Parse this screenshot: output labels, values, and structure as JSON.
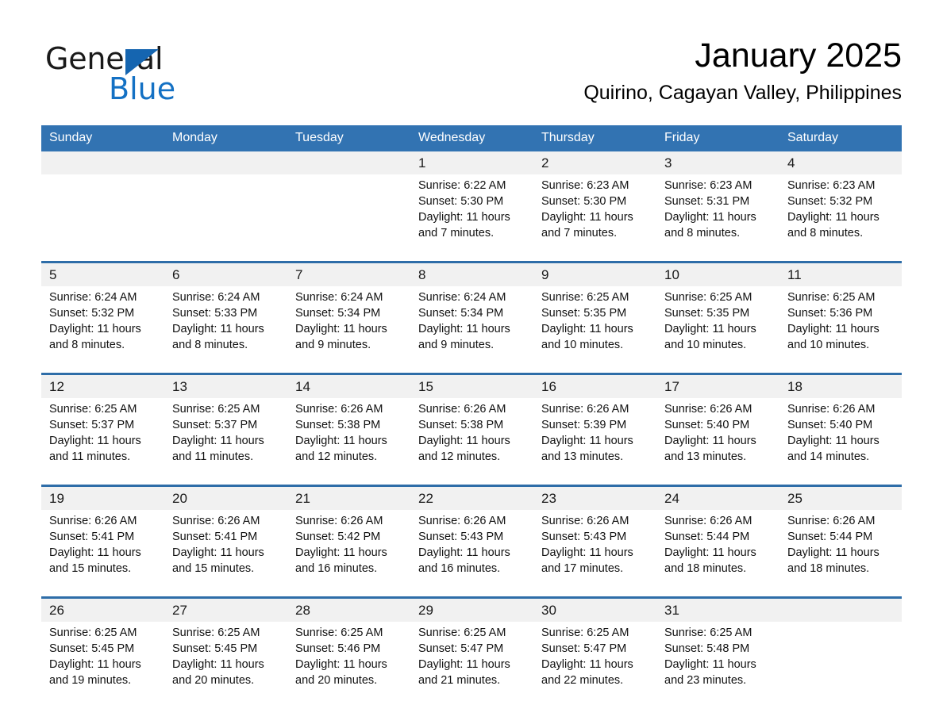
{
  "brand": {
    "name_part1": "General",
    "name_part2": "Blue",
    "logo_icon": "triangle-logo-icon"
  },
  "header": {
    "month_title": "January 2025",
    "location": "Quirino, Cagayan Valley, Philippines"
  },
  "colors": {
    "header_blue": "#3273b2",
    "separator_blue": "#2e6da8",
    "daynum_bg": "#f1f1f1",
    "brand_blue": "#1471c4"
  },
  "calendar": {
    "weekday_headers": [
      "Sunday",
      "Monday",
      "Tuesday",
      "Wednesday",
      "Thursday",
      "Friday",
      "Saturday"
    ],
    "weeks": [
      {
        "days": [
          {
            "num": "",
            "sunrise": "",
            "sunset": "",
            "daylight_1": "",
            "daylight_2": "",
            "empty": true
          },
          {
            "num": "",
            "sunrise": "",
            "sunset": "",
            "daylight_1": "",
            "daylight_2": "",
            "empty": true
          },
          {
            "num": "",
            "sunrise": "",
            "sunset": "",
            "daylight_1": "",
            "daylight_2": "",
            "empty": true
          },
          {
            "num": "1",
            "sunrise": "Sunrise: 6:22 AM",
            "sunset": "Sunset: 5:30 PM",
            "daylight_1": "Daylight: 11 hours",
            "daylight_2": "and 7 minutes.",
            "empty": false
          },
          {
            "num": "2",
            "sunrise": "Sunrise: 6:23 AM",
            "sunset": "Sunset: 5:30 PM",
            "daylight_1": "Daylight: 11 hours",
            "daylight_2": "and 7 minutes.",
            "empty": false
          },
          {
            "num": "3",
            "sunrise": "Sunrise: 6:23 AM",
            "sunset": "Sunset: 5:31 PM",
            "daylight_1": "Daylight: 11 hours",
            "daylight_2": "and 8 minutes.",
            "empty": false
          },
          {
            "num": "4",
            "sunrise": "Sunrise: 6:23 AM",
            "sunset": "Sunset: 5:32 PM",
            "daylight_1": "Daylight: 11 hours",
            "daylight_2": "and 8 minutes.",
            "empty": false
          }
        ]
      },
      {
        "days": [
          {
            "num": "5",
            "sunrise": "Sunrise: 6:24 AM",
            "sunset": "Sunset: 5:32 PM",
            "daylight_1": "Daylight: 11 hours",
            "daylight_2": "and 8 minutes.",
            "empty": false
          },
          {
            "num": "6",
            "sunrise": "Sunrise: 6:24 AM",
            "sunset": "Sunset: 5:33 PM",
            "daylight_1": "Daylight: 11 hours",
            "daylight_2": "and 8 minutes.",
            "empty": false
          },
          {
            "num": "7",
            "sunrise": "Sunrise: 6:24 AM",
            "sunset": "Sunset: 5:34 PM",
            "daylight_1": "Daylight: 11 hours",
            "daylight_2": "and 9 minutes.",
            "empty": false
          },
          {
            "num": "8",
            "sunrise": "Sunrise: 6:24 AM",
            "sunset": "Sunset: 5:34 PM",
            "daylight_1": "Daylight: 11 hours",
            "daylight_2": "and 9 minutes.",
            "empty": false
          },
          {
            "num": "9",
            "sunrise": "Sunrise: 6:25 AM",
            "sunset": "Sunset: 5:35 PM",
            "daylight_1": "Daylight: 11 hours",
            "daylight_2": "and 10 minutes.",
            "empty": false
          },
          {
            "num": "10",
            "sunrise": "Sunrise: 6:25 AM",
            "sunset": "Sunset: 5:35 PM",
            "daylight_1": "Daylight: 11 hours",
            "daylight_2": "and 10 minutes.",
            "empty": false
          },
          {
            "num": "11",
            "sunrise": "Sunrise: 6:25 AM",
            "sunset": "Sunset: 5:36 PM",
            "daylight_1": "Daylight: 11 hours",
            "daylight_2": "and 10 minutes.",
            "empty": false
          }
        ]
      },
      {
        "days": [
          {
            "num": "12",
            "sunrise": "Sunrise: 6:25 AM",
            "sunset": "Sunset: 5:37 PM",
            "daylight_1": "Daylight: 11 hours",
            "daylight_2": "and 11 minutes.",
            "empty": false
          },
          {
            "num": "13",
            "sunrise": "Sunrise: 6:25 AM",
            "sunset": "Sunset: 5:37 PM",
            "daylight_1": "Daylight: 11 hours",
            "daylight_2": "and 11 minutes.",
            "empty": false
          },
          {
            "num": "14",
            "sunrise": "Sunrise: 6:26 AM",
            "sunset": "Sunset: 5:38 PM",
            "daylight_1": "Daylight: 11 hours",
            "daylight_2": "and 12 minutes.",
            "empty": false
          },
          {
            "num": "15",
            "sunrise": "Sunrise: 6:26 AM",
            "sunset": "Sunset: 5:38 PM",
            "daylight_1": "Daylight: 11 hours",
            "daylight_2": "and 12 minutes.",
            "empty": false
          },
          {
            "num": "16",
            "sunrise": "Sunrise: 6:26 AM",
            "sunset": "Sunset: 5:39 PM",
            "daylight_1": "Daylight: 11 hours",
            "daylight_2": "and 13 minutes.",
            "empty": false
          },
          {
            "num": "17",
            "sunrise": "Sunrise: 6:26 AM",
            "sunset": "Sunset: 5:40 PM",
            "daylight_1": "Daylight: 11 hours",
            "daylight_2": "and 13 minutes.",
            "empty": false
          },
          {
            "num": "18",
            "sunrise": "Sunrise: 6:26 AM",
            "sunset": "Sunset: 5:40 PM",
            "daylight_1": "Daylight: 11 hours",
            "daylight_2": "and 14 minutes.",
            "empty": false
          }
        ]
      },
      {
        "days": [
          {
            "num": "19",
            "sunrise": "Sunrise: 6:26 AM",
            "sunset": "Sunset: 5:41 PM",
            "daylight_1": "Daylight: 11 hours",
            "daylight_2": "and 15 minutes.",
            "empty": false
          },
          {
            "num": "20",
            "sunrise": "Sunrise: 6:26 AM",
            "sunset": "Sunset: 5:41 PM",
            "daylight_1": "Daylight: 11 hours",
            "daylight_2": "and 15 minutes.",
            "empty": false
          },
          {
            "num": "21",
            "sunrise": "Sunrise: 6:26 AM",
            "sunset": "Sunset: 5:42 PM",
            "daylight_1": "Daylight: 11 hours",
            "daylight_2": "and 16 minutes.",
            "empty": false
          },
          {
            "num": "22",
            "sunrise": "Sunrise: 6:26 AM",
            "sunset": "Sunset: 5:43 PM",
            "daylight_1": "Daylight: 11 hours",
            "daylight_2": "and 16 minutes.",
            "empty": false
          },
          {
            "num": "23",
            "sunrise": "Sunrise: 6:26 AM",
            "sunset": "Sunset: 5:43 PM",
            "daylight_1": "Daylight: 11 hours",
            "daylight_2": "and 17 minutes.",
            "empty": false
          },
          {
            "num": "24",
            "sunrise": "Sunrise: 6:26 AM",
            "sunset": "Sunset: 5:44 PM",
            "daylight_1": "Daylight: 11 hours",
            "daylight_2": "and 18 minutes.",
            "empty": false
          },
          {
            "num": "25",
            "sunrise": "Sunrise: 6:26 AM",
            "sunset": "Sunset: 5:44 PM",
            "daylight_1": "Daylight: 11 hours",
            "daylight_2": "and 18 minutes.",
            "empty": false
          }
        ]
      },
      {
        "days": [
          {
            "num": "26",
            "sunrise": "Sunrise: 6:25 AM",
            "sunset": "Sunset: 5:45 PM",
            "daylight_1": "Daylight: 11 hours",
            "daylight_2": "and 19 minutes.",
            "empty": false
          },
          {
            "num": "27",
            "sunrise": "Sunrise: 6:25 AM",
            "sunset": "Sunset: 5:45 PM",
            "daylight_1": "Daylight: 11 hours",
            "daylight_2": "and 20 minutes.",
            "empty": false
          },
          {
            "num": "28",
            "sunrise": "Sunrise: 6:25 AM",
            "sunset": "Sunset: 5:46 PM",
            "daylight_1": "Daylight: 11 hours",
            "daylight_2": "and 20 minutes.",
            "empty": false
          },
          {
            "num": "29",
            "sunrise": "Sunrise: 6:25 AM",
            "sunset": "Sunset: 5:47 PM",
            "daylight_1": "Daylight: 11 hours",
            "daylight_2": "and 21 minutes.",
            "empty": false
          },
          {
            "num": "30",
            "sunrise": "Sunrise: 6:25 AM",
            "sunset": "Sunset: 5:47 PM",
            "daylight_1": "Daylight: 11 hours",
            "daylight_2": "and 22 minutes.",
            "empty": false
          },
          {
            "num": "31",
            "sunrise": "Sunrise: 6:25 AM",
            "sunset": "Sunset: 5:48 PM",
            "daylight_1": "Daylight: 11 hours",
            "daylight_2": "and 23 minutes.",
            "empty": false
          },
          {
            "num": "",
            "sunrise": "",
            "sunset": "",
            "daylight_1": "",
            "daylight_2": "",
            "empty": true
          }
        ]
      }
    ]
  }
}
